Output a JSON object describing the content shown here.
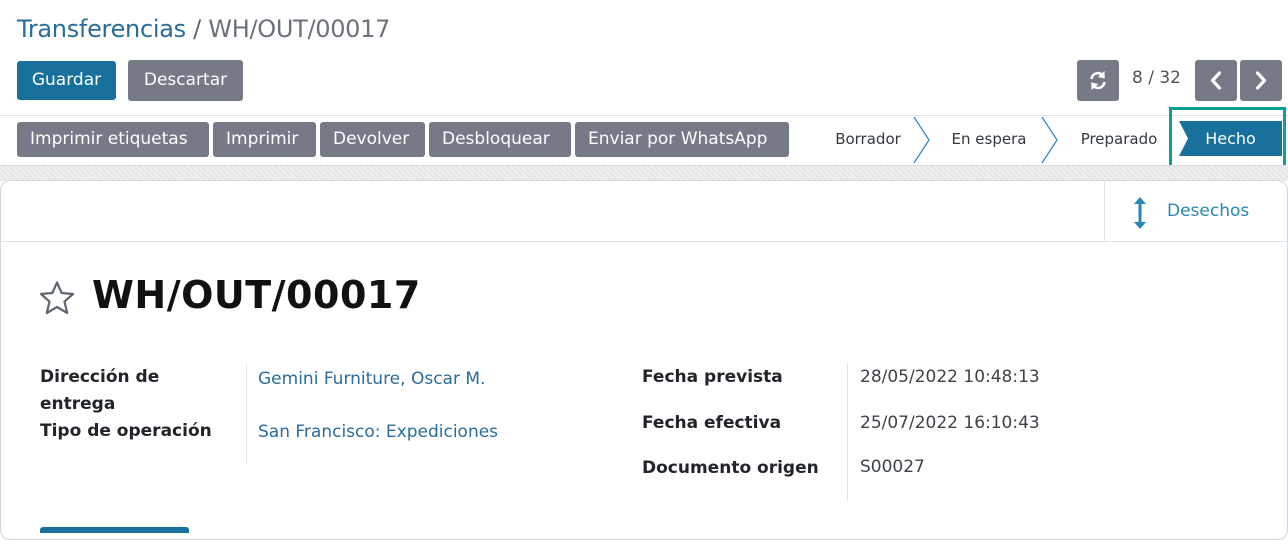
{
  "breadcrumb": {
    "parent": "Transferencias",
    "separator": " / ",
    "current": "WH/OUT/00017"
  },
  "actions": {
    "save": "Guardar",
    "discard": "Descartar"
  },
  "pager": {
    "value": "8 / 32"
  },
  "statusbar": {
    "buttons": [
      "Imprimir etiquetas",
      "Imprimir",
      "Devolver",
      "Desbloquear",
      "Enviar por WhatsApp"
    ],
    "stages": [
      "Borrador",
      "En espera",
      "Preparado",
      "Hecho"
    ],
    "active_stage": "Hecho"
  },
  "smart_buttons": {
    "scrap": "Desechos"
  },
  "record": {
    "title": "WH/OUT/00017",
    "left_fields": [
      {
        "label": "Dirección de entrega",
        "label_line1": "Dirección de",
        "label_line2": "entrega",
        "value": "Gemini Furniture, Oscar M."
      },
      {
        "label": "Tipo de operación",
        "value": "San Francisco: Expediciones"
      }
    ],
    "right_fields": [
      {
        "label": "Fecha prevista",
        "value": "28/05/2022 10:48:13"
      },
      {
        "label": "Fecha efectiva",
        "value": "25/07/2022 16:10:43"
      },
      {
        "label": "Documento origen",
        "value": "S00027"
      }
    ]
  },
  "colors": {
    "primary": "#17719c",
    "secondary": "#757a86",
    "link": "#2a6c9a",
    "highlight": "#0d9e95"
  },
  "icons": [
    "refresh-icon",
    "chevron-left-icon",
    "chevron-right-icon",
    "vertical-arrows-icon",
    "star-icon"
  ]
}
